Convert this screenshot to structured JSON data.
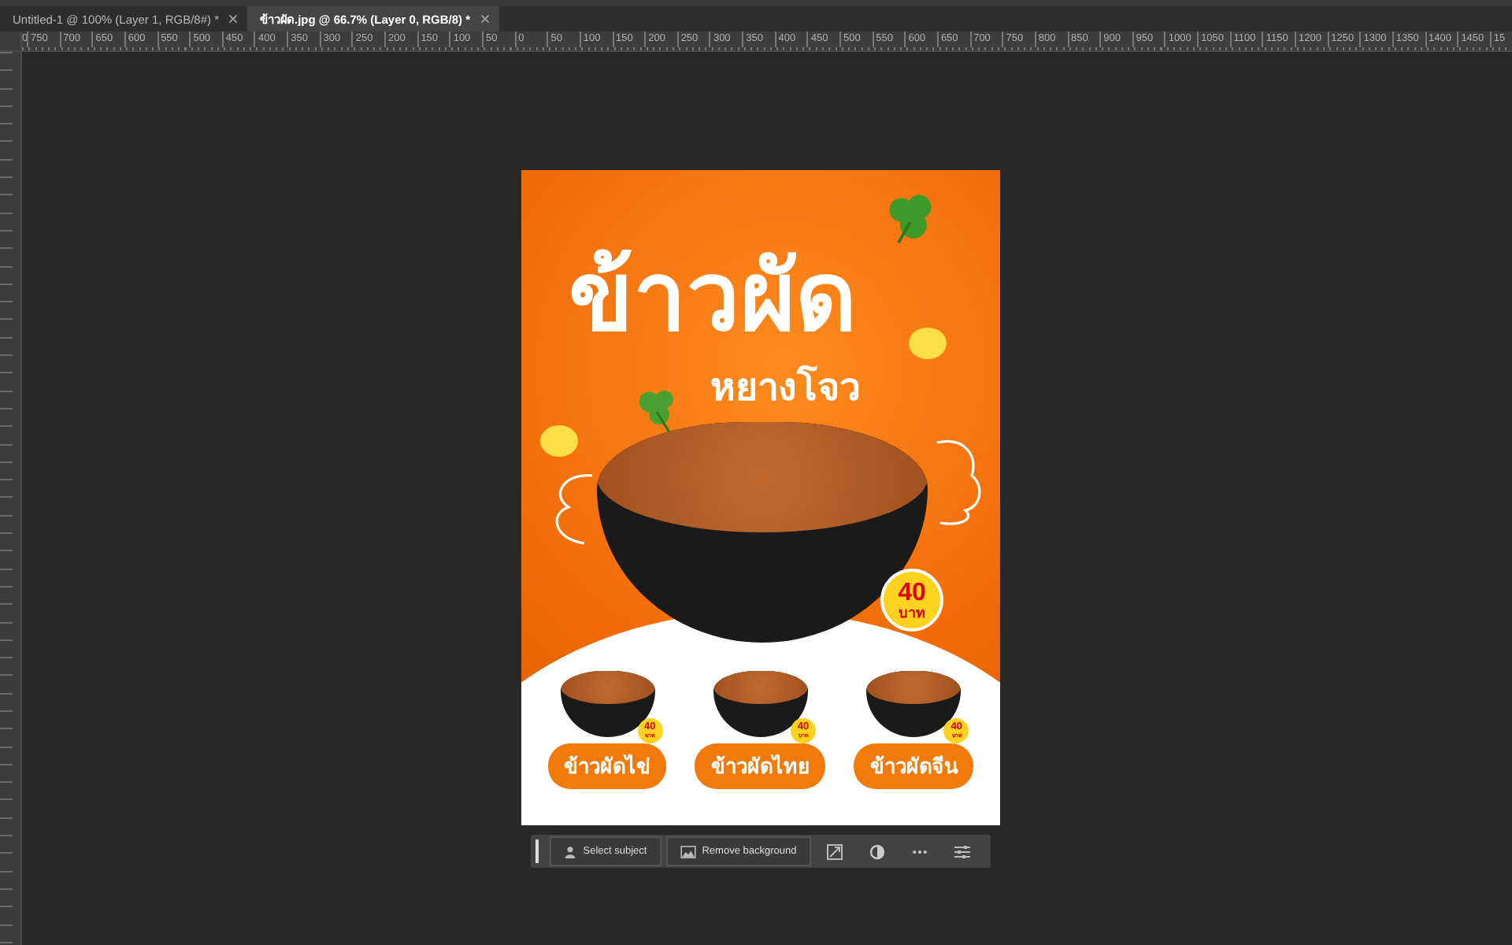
{
  "tabs": [
    {
      "label": "Untitled-1 @ 100% (Layer 1, RGB/8#) *",
      "selected": false
    },
    {
      "label": "ข้าวผัด.jpg @ 66.7% (Layer 0, RGB/8) *",
      "selected": true
    }
  ],
  "ruler_labels": [
    "0",
    "750",
    "700",
    "650",
    "600",
    "550",
    "500",
    "450",
    "400",
    "350",
    "300",
    "250",
    "200",
    "150",
    "100",
    "50",
    "0",
    "50",
    "100",
    "150",
    "200",
    "250",
    "300",
    "350",
    "400",
    "450",
    "500",
    "550",
    "600",
    "650",
    "700",
    "750",
    "800",
    "850",
    "900",
    "950",
    "1000",
    "1050",
    "1100",
    "1150",
    "1200",
    "1250",
    "1300",
    "1350",
    "1400",
    "1450",
    "15"
  ],
  "poster": {
    "title": "ข้าวผัด",
    "subtitle": "หยางโจว",
    "price": {
      "amount": "40",
      "unit": "บาท"
    },
    "dishes": [
      {
        "name": "ข้าวผัดไข่",
        "price": "40",
        "unit": "บาท"
      },
      {
        "name": "ข้าวผัดไทย",
        "price": "40",
        "unit": "บาท"
      },
      {
        "name": "ข้าวผัดจีน",
        "price": "40",
        "unit": "บาท"
      }
    ]
  },
  "contextual_taskbar": {
    "buttons": [
      "Select subject",
      "Remove background"
    ]
  }
}
